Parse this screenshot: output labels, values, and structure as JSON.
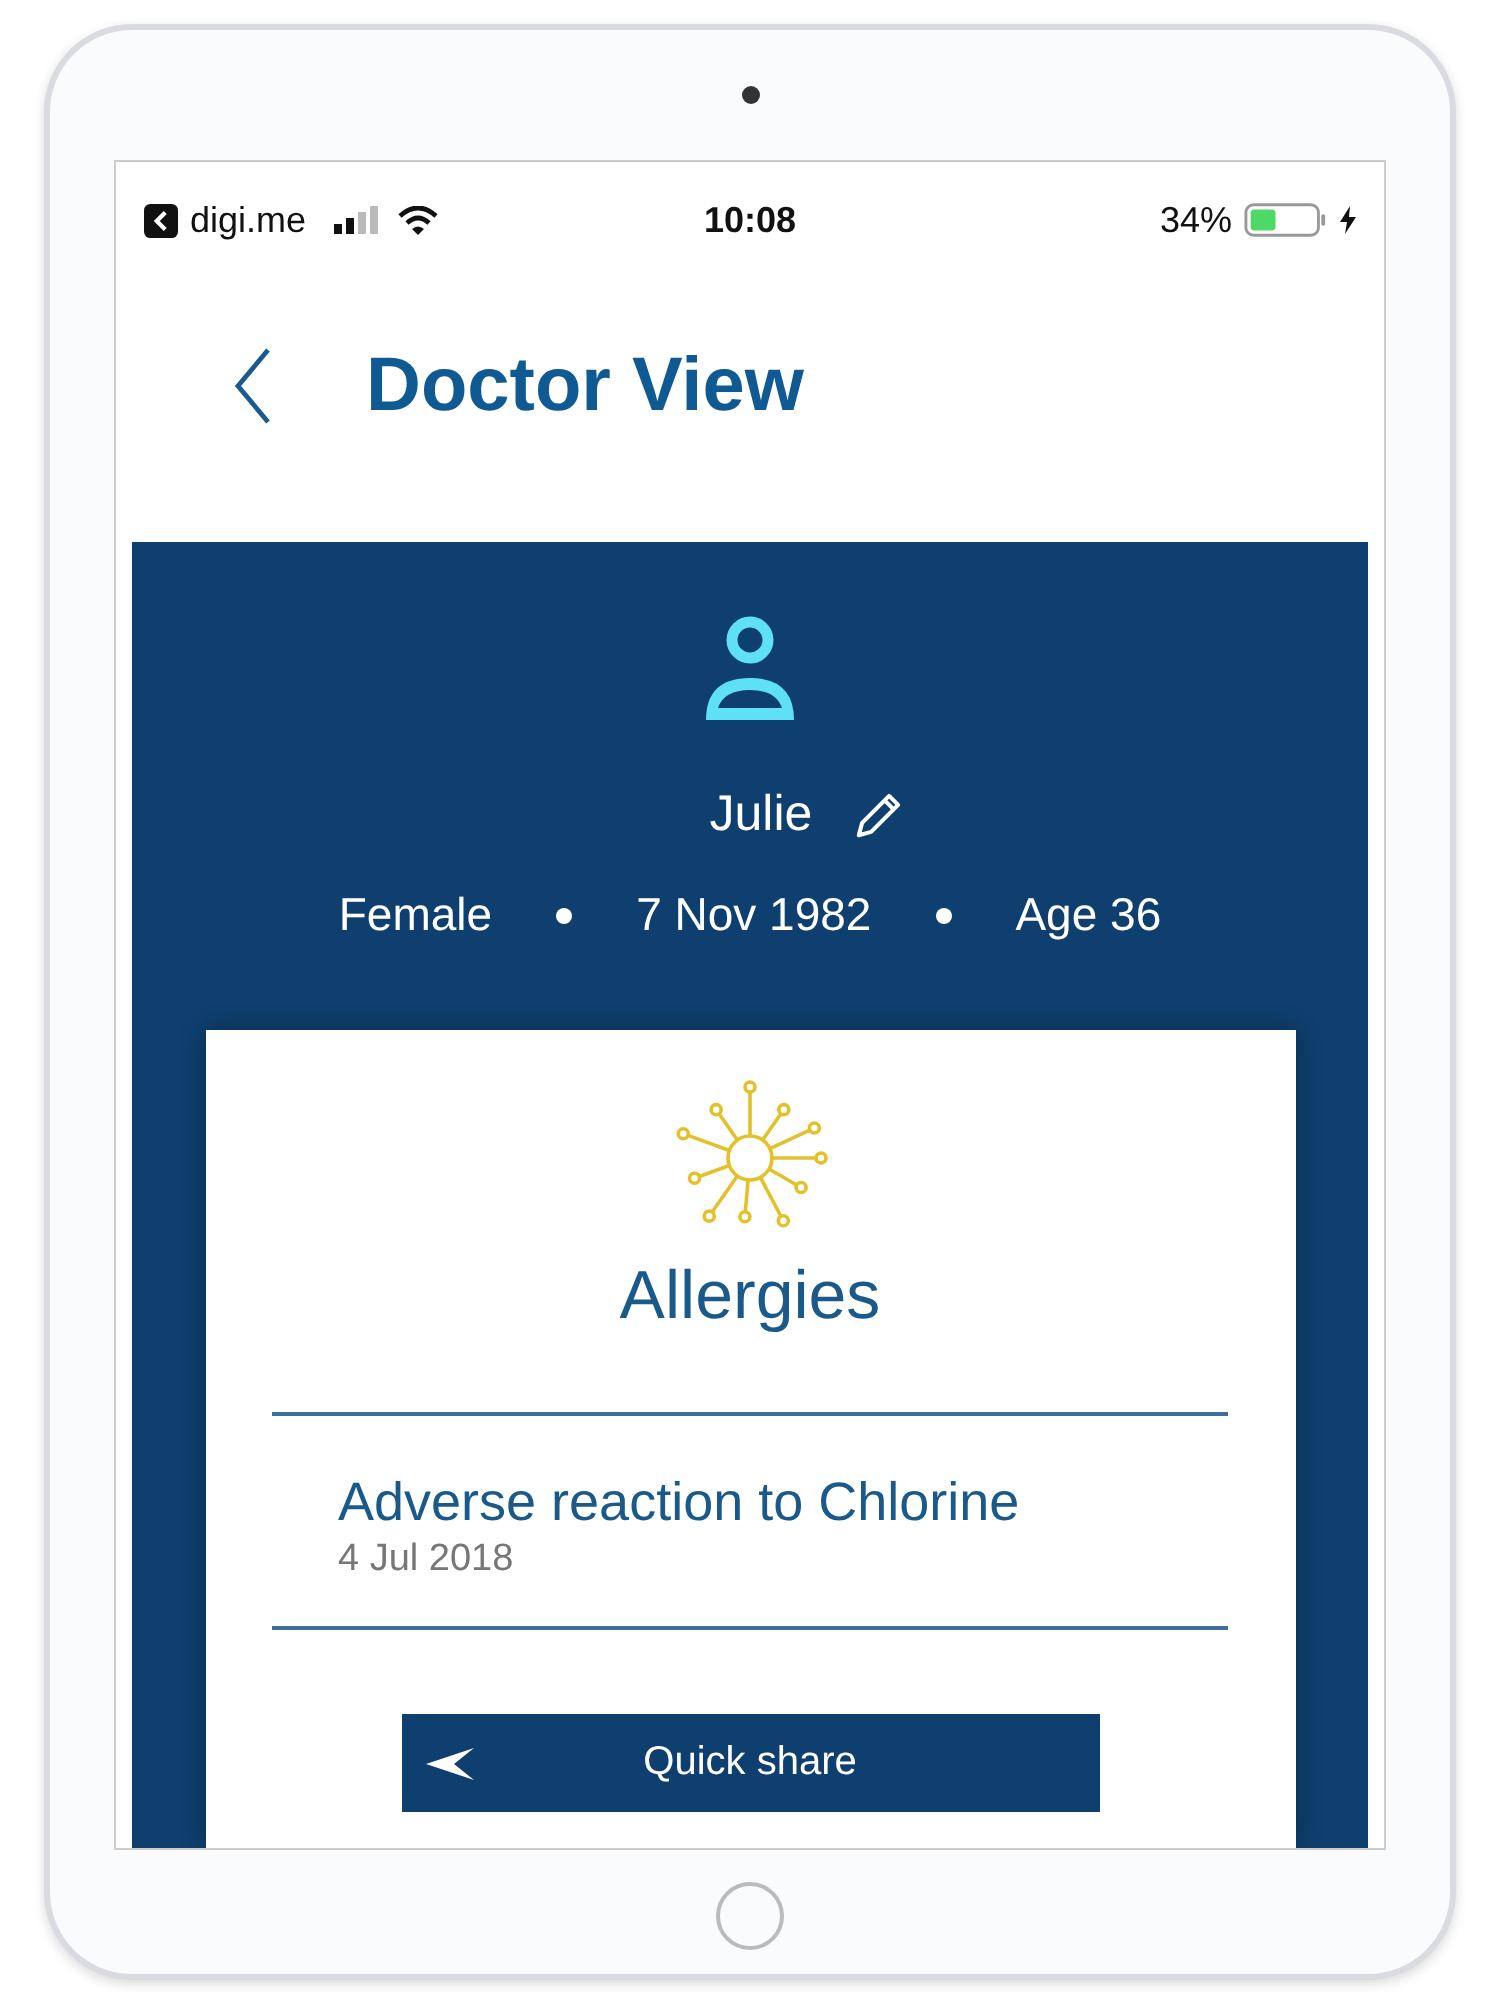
{
  "status_bar": {
    "back_app": "digi.me",
    "time": "10:08",
    "battery": "34%"
  },
  "header": {
    "title": "Doctor View"
  },
  "patient": {
    "name": "Julie",
    "gender": "Female",
    "birth_date": "7 Nov 1982",
    "age": "Age 36"
  },
  "card": {
    "title": "Allergies",
    "entries": [
      {
        "title": "Adverse reaction to Chlorine",
        "date": "4 Jul 2018"
      }
    ],
    "button": "Quick share"
  }
}
